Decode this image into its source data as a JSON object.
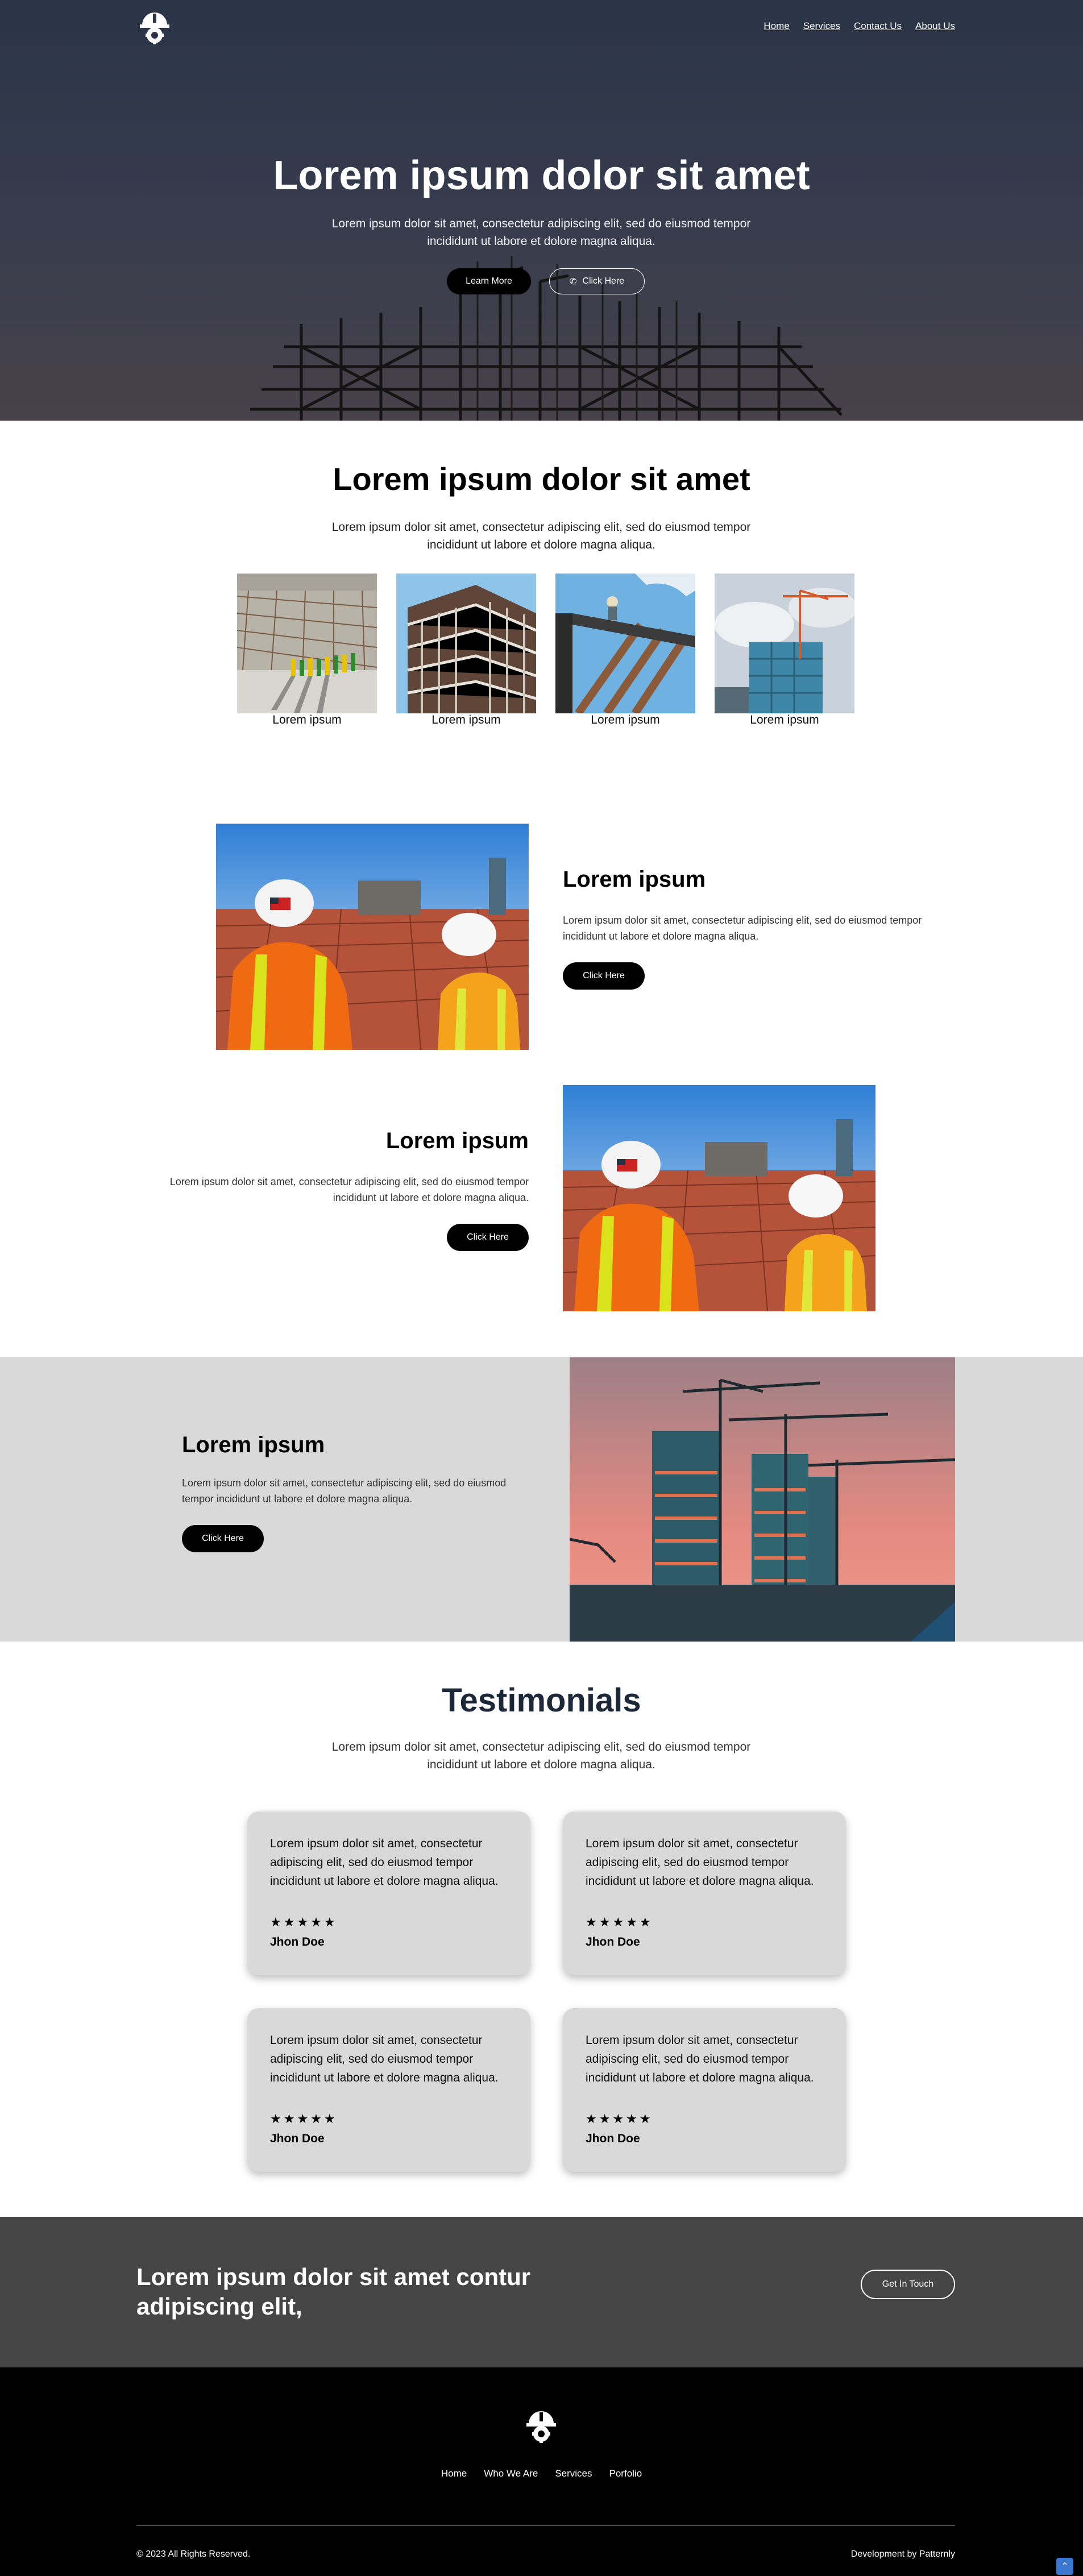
{
  "nav": {
    "home": "Home",
    "services": "Services",
    "contact": "Contact Us",
    "about": "About Us"
  },
  "hero": {
    "title": "Lorem ipsum dolor sit amet",
    "text": "Lorem ipsum dolor sit amet, consectetur adipiscing elit, sed do eiusmod tempor incididunt ut labore et dolore magna aliqua.",
    "learn_more": "Learn More",
    "click_here": "Click Here"
  },
  "intro": {
    "title": "Lorem ipsum dolor sit amet",
    "text": "Lorem ipsum dolor sit amet, consectetur adipiscing elit, sed do eiusmod tempor incididunt ut labore et dolore magna aliqua.",
    "captions": [
      "Lorem ipsum",
      "Lorem ipsum",
      "Lorem ipsum",
      "Lorem ipsum"
    ]
  },
  "feature1": {
    "title": "Lorem ipsum",
    "text": "Lorem ipsum dolor sit amet, consectetur adipiscing elit, sed do eiusmod tempor incididunt ut labore et dolore magna aliqua.",
    "button": "Click Here"
  },
  "feature2": {
    "title": "Lorem ipsum",
    "text": "Lorem ipsum dolor sit amet, consectetur adipiscing elit, sed do eiusmod tempor incididunt ut labore et dolore magna aliqua.",
    "button": "Click Here"
  },
  "feature3": {
    "title": "Lorem ipsum",
    "text": "Lorem ipsum dolor sit amet, consectetur adipiscing elit, sed do eiusmod tempor incididunt ut labore et dolore magna aliqua.",
    "button": "Click Here"
  },
  "testimonials": {
    "title": "Testimonials",
    "text": "Lorem ipsum dolor sit amet, consectetur adipiscing elit, sed do eiusmod tempor incididunt ut labore et dolore magna aliqua.",
    "items": [
      {
        "quote": "Lorem ipsum dolor sit amet, consectetur adipiscing elit, sed do eiusmod tempor incididunt ut labore et dolore magna aliqua.",
        "stars": "★★★★★",
        "rating": 5,
        "name": "Jhon Doe"
      },
      {
        "quote": "Lorem ipsum dolor sit amet, consectetur adipiscing elit, sed do eiusmod tempor incididunt ut labore et dolore magna aliqua.",
        "stars": "★★★★★",
        "rating": 5,
        "name": "Jhon Doe"
      },
      {
        "quote": "Lorem ipsum dolor sit amet, consectetur adipiscing elit, sed do eiusmod tempor incididunt ut labore et dolore magna aliqua.",
        "stars": "★★★★★",
        "rating": 5,
        "name": "Jhon Doe"
      },
      {
        "quote": "Lorem ipsum dolor sit amet, consectetur adipiscing elit, sed do eiusmod tempor incididunt ut labore et dolore magna aliqua.",
        "stars": "★★★★★",
        "rating": 5,
        "name": "Jhon Doe"
      }
    ]
  },
  "cta": {
    "title": "Lorem ipsum dolor sit amet contur adipiscing elit,",
    "button": "Get In Touch"
  },
  "footer": {
    "links": [
      "Home",
      "Who We Are",
      "Services",
      "Porfolio"
    ],
    "copyright": "© 2023 All Rights Reserved.",
    "developer": "Development by Patternly"
  },
  "icons": {
    "logo": "hardhat-gear-logo-icon",
    "phone": "phone-icon",
    "star": "star-icon",
    "back_to_top": "chevron-up-icon"
  },
  "colors": {
    "hero_bg": "#333a4b",
    "accent_button": "#000000",
    "gray_panel": "#d9d9d9",
    "cta_bg": "#454545",
    "footer_bg": "#000000",
    "heading_dark": "#1c2738",
    "back_to_top": "#3b76cf"
  }
}
